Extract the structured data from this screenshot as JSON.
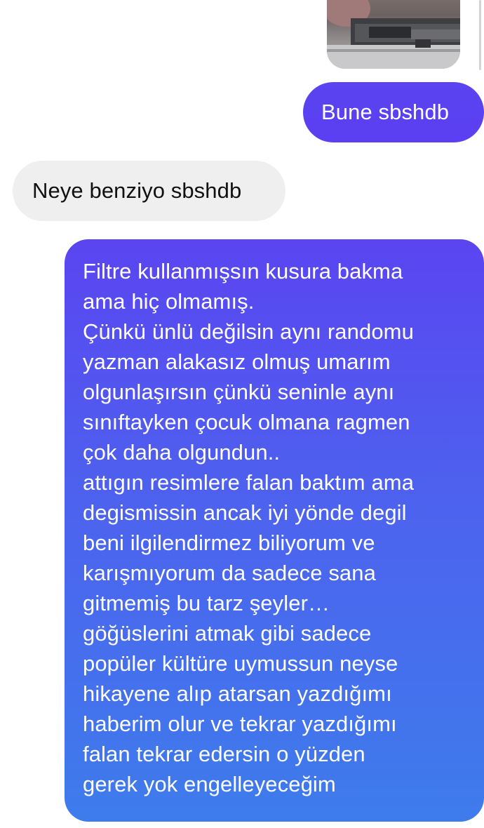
{
  "conversation": {
    "messages": [
      {
        "side": "sent",
        "text": "Bune sbshdb"
      },
      {
        "side": "received",
        "text": "Neye benziyo sbshdb"
      }
    ],
    "long_message": {
      "side": "sent",
      "lines": [
        "Filtre kullanmışsın kusura bakma",
        "ama hiç olmamış.",
        "Çünkü ünlü değilsin  aynı randomu",
        "yazman alakasız olmuş umarım",
        "olgunlaşırsın çünkü seninle aynı",
        "sınıftayken çocuk olmana ragmen",
        "çok daha olgundun..",
        "attıgın resimlere falan baktım ama",
        "degismissin ancak iyi yönde degil",
        "beni ilgilendirmez biliyorum ve",
        "karışmıyorum da sadece sana",
        "gitmemiş bu tarz şeyler…",
        "göğüslerini atmak gibi sadece",
        "popüler kültüre uymussun neyse",
        "hikayene alıp atarsan yazdığımı",
        "haberim olur ve tekrar yazdığımı",
        "falan tekrar edersin o yüzden",
        "gerek yok engelleyeceğim"
      ]
    }
  },
  "colors": {
    "sent_bubble_top": "#5a45f1",
    "sent_bubble_bottom": "#3e7cec",
    "received_bubble": "#efefef",
    "background": "#ffffff"
  }
}
